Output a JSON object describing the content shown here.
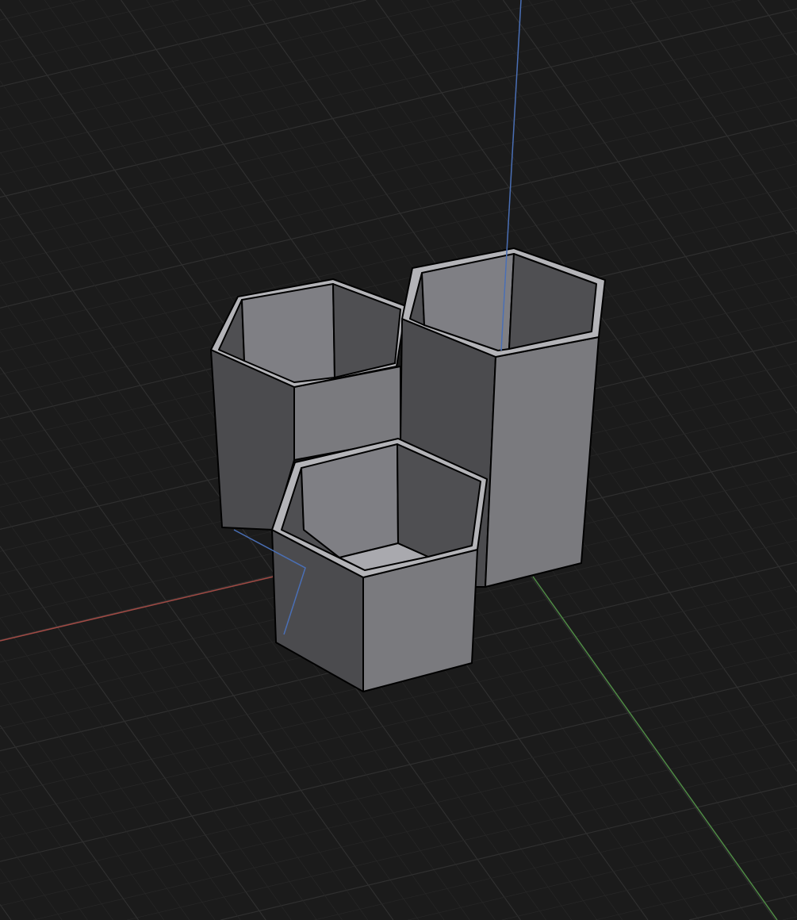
{
  "viewport": {
    "background": "#1b1b1b",
    "grid_minor": "#262626",
    "grid_major": "#2f2f2f",
    "axis_x_color": "#a04a44",
    "axis_y_color": "#4f8a45",
    "axis_z_color": "#4a6fb5"
  },
  "materials": {
    "face_light": "#7a7a7e",
    "face_dark": "#4b4b4e",
    "rim": "#b4b4b8",
    "inner_light": "#7f7f84",
    "inner_dark": "#4f4f52",
    "floor": "#a9a9ae"
  }
}
